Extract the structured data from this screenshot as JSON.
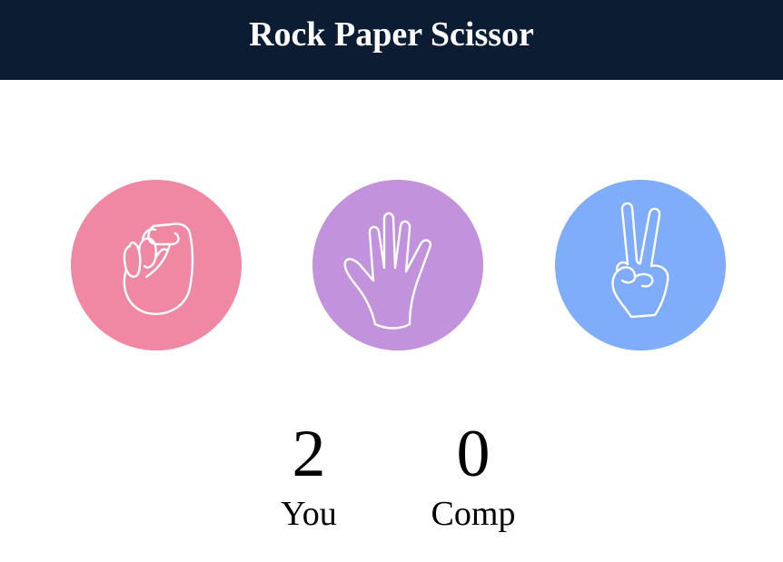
{
  "header": {
    "title": "Rock Paper Scissor",
    "background": "#0b1c33",
    "text_color": "#ffffff"
  },
  "choices": [
    {
      "id": "rock",
      "icon": "fist-icon",
      "color": "#f088a4"
    },
    {
      "id": "paper",
      "icon": "open-hand-icon",
      "color": "#c392dc"
    },
    {
      "id": "scissors",
      "icon": "peace-sign-icon",
      "color": "#80acfc"
    }
  ],
  "scoreboard": {
    "user": {
      "score": "2",
      "label": "You"
    },
    "comp": {
      "score": "0",
      "label": "Comp"
    }
  }
}
